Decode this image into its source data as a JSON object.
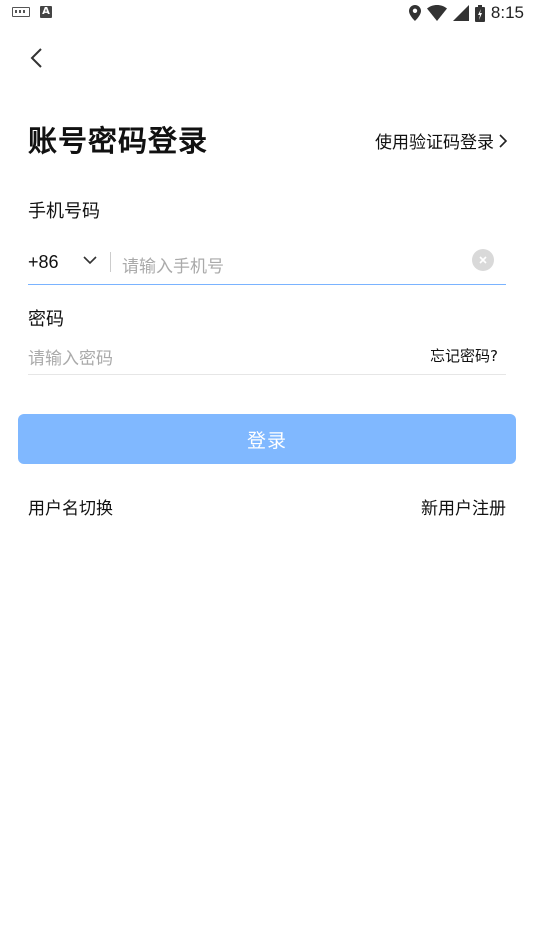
{
  "status_bar": {
    "time": "8:15",
    "left_icons": [
      "keyboard-icon",
      "a-icon"
    ],
    "right_icons": [
      "location-icon",
      "wifi-icon",
      "signal-icon",
      "battery-icon"
    ]
  },
  "header": {
    "title": "账号密码登录",
    "switch_link": "使用验证码登录"
  },
  "phone": {
    "label": "手机号码",
    "country_code": "+86",
    "placeholder": "请输入手机号"
  },
  "password": {
    "label": "密码",
    "placeholder": "请输入密码",
    "forgot": "忘记密码?"
  },
  "login_button": "登录",
  "footer": {
    "switch_username": "用户名切换",
    "register": "新用户注册"
  },
  "colors": {
    "accent": "#80b8ff",
    "input_underline": "#7ab3ff"
  }
}
